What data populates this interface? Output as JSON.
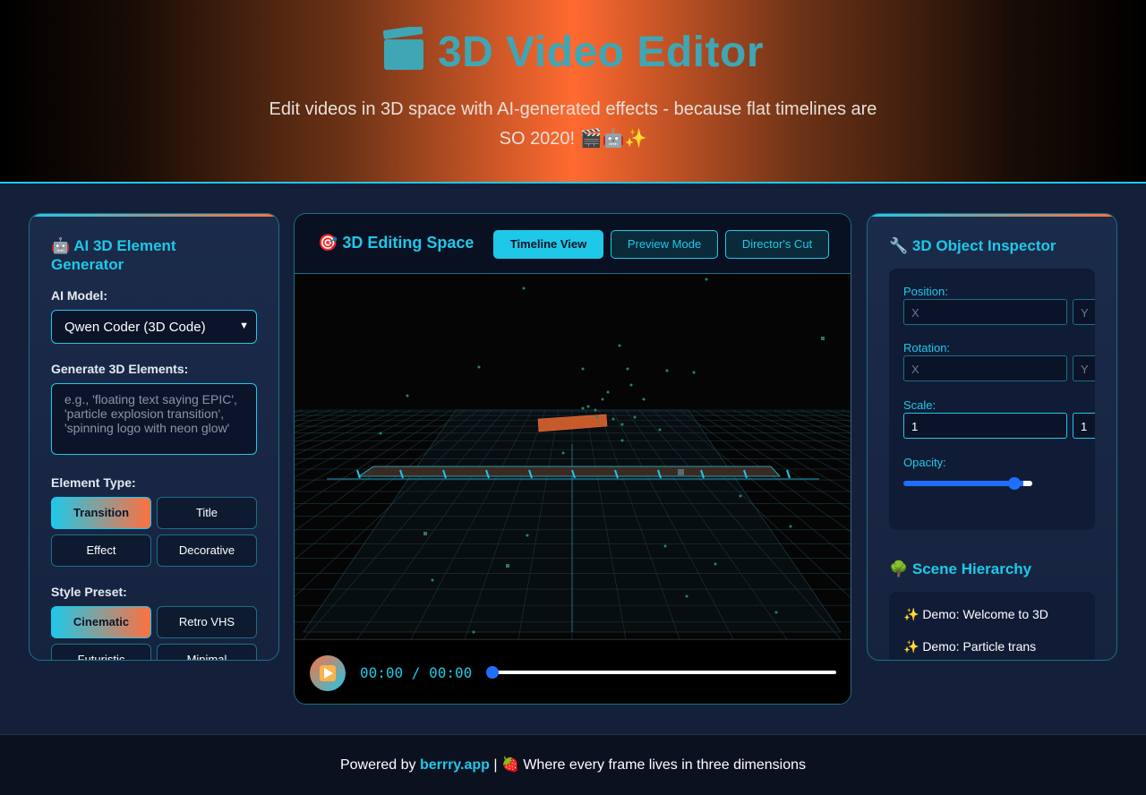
{
  "header": {
    "title": "3D Video Editor",
    "subtitle": "Edit videos in 3D space with AI-generated effects - because flat timelines are SO 2020! 🎬🤖✨"
  },
  "generator": {
    "title": "🤖 AI 3D Element Generator",
    "model_label": "AI Model:",
    "model_value": "Qwen Coder (3D Code)",
    "prompt_label": "Generate 3D Elements:",
    "prompt_placeholder": "e.g., 'floating text saying EPIC', 'particle explosion transition', 'spinning logo with neon glow'",
    "type_label": "Element Type:",
    "types": [
      "Transition",
      "Title",
      "Effect",
      "Decorative"
    ],
    "style_label": "Style Preset:",
    "styles": [
      "Cinematic",
      "Retro VHS",
      "Futuristic",
      "Minimal"
    ]
  },
  "editor": {
    "title": "🎯 3D Editing Space",
    "views": [
      "Timeline View",
      "Preview Mode",
      "Director's Cut"
    ],
    "time": "00:00 / 00:00",
    "progress": 0
  },
  "inspector": {
    "title": "🔧 3D Object Inspector",
    "position_label": "Position:",
    "rotation_label": "Rotation:",
    "scale_label": "Scale:",
    "opacity_label": "Opacity:",
    "x_placeholder": "X",
    "y_placeholder": "Y",
    "scale_x": "1",
    "scale_y": "1",
    "opacity": 0.9,
    "hierarchy_title": "🌳 Scene Hierarchy",
    "hierarchy": [
      "✨ Demo: Welcome to 3D",
      "✨ Demo: Particle trans"
    ]
  },
  "footer": {
    "prefix": "Powered by",
    "brand": "berrry.app",
    "suffix": "| 🍓 Where every frame lives in three dimensions"
  },
  "colors": {
    "accent": "#1fc8e8",
    "orange": "#ff7040",
    "bg": "#14203a"
  }
}
